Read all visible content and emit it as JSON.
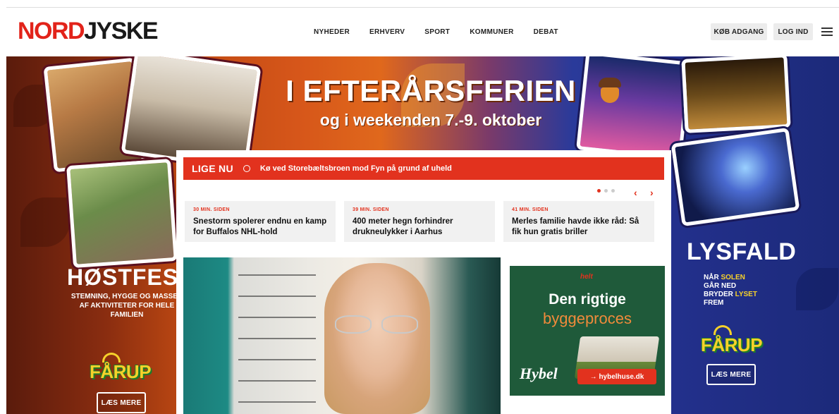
{
  "header": {
    "logo_part1": "NORD",
    "logo_part2": "JYSKE",
    "nav": [
      "NYHEDER",
      "ERHVERV",
      "SPORT",
      "KOMMUNER",
      "DEBAT"
    ],
    "buy_label": "KØB ADGANG",
    "login_label": "LOG IND"
  },
  "banner": {
    "headline": "I EFTERÅRSFERIEN",
    "subheadline": "og i weekenden 7.-9. oktober",
    "left": {
      "title": "HØSTFEST",
      "subtitle": "STEMNING, HYGGE OG MASSER AF AKTIVITETER FOR HELE FAMILIEN",
      "brand": "FÅRUP",
      "cta": "LÆS MERE"
    },
    "right": {
      "title": "LYSFALD",
      "line1_a": "NÅR ",
      "line1_b": "SOLEN",
      "line2": "GÅR NED",
      "line3_a": "BRYDER ",
      "line3_b": "LYSET",
      "line4": "FREM",
      "brand": "FÅRUP",
      "cta": "LÆS MERE"
    }
  },
  "live": {
    "label": "LIGE NU",
    "text": "Kø ved Storebæltsbroen mod Fyn på grund af uheld"
  },
  "news": [
    {
      "time": "30 MIN. SIDEN",
      "title": "Snestorm spolerer endnu en kamp for Buffalos NHL-hold"
    },
    {
      "time": "39 MIN. SIDEN",
      "title": "400 meter hegn forhindrer drukneulykker i Aarhus"
    },
    {
      "time": "41 MIN. SIDEN",
      "title": "Merles familie havde ikke råd: Så fik hun gratis briller"
    }
  ],
  "ad": {
    "helt": "helt",
    "line1": "Den rigtige",
    "line2": "byggeproces",
    "brand": "Hybel",
    "cta": "hybelhuse.dk"
  },
  "colors": {
    "brand_red": "#e2231a",
    "live_red": "#e2321e",
    "ad_green": "#1f5a3a",
    "farup_yellow": "#f6d12a"
  }
}
